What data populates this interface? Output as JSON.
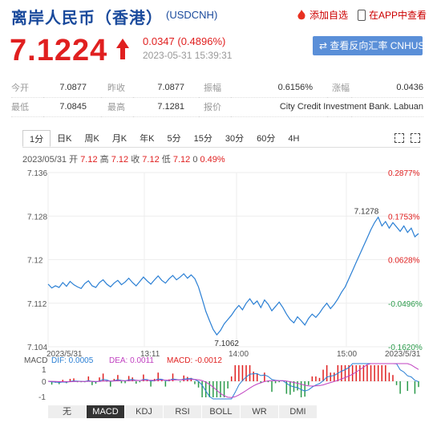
{
  "header": {
    "title": "离岸人民币（香港）",
    "code": "(USDCNH)",
    "fav_label": "添加自选",
    "app_label": "在APP中查看"
  },
  "quote": {
    "price": "7.1224",
    "change": "0.0347 (0.4896%)",
    "timestamp": "2023-05-31  15:39:31",
    "reverse_button": "查看反向汇率 CNHUSD"
  },
  "stats": [
    [
      {
        "l": "今开",
        "v": "7.0877"
      },
      {
        "l": "昨收",
        "v": "7.0877"
      },
      {
        "l": "振幅",
        "v": "0.6156%"
      },
      {
        "l": "涨幅",
        "v": "0.0436"
      }
    ],
    [
      {
        "l": "最低",
        "v": "7.0845"
      },
      {
        "l": "最高",
        "v": "7.1281"
      },
      {
        "l": "报价",
        "v": "City Credit Investment Bank. Labuan"
      }
    ]
  ],
  "tabs": [
    "1分",
    "日K",
    "周K",
    "月K",
    "年K",
    "5分",
    "15分",
    "30分",
    "60分",
    "4H"
  ],
  "info_line": {
    "date": "2023/05/31",
    "items": [
      [
        "开",
        "7.12"
      ],
      [
        "高",
        "7.12"
      ],
      [
        "收",
        "7.12"
      ],
      [
        "低",
        "7.12"
      ]
    ],
    "vol": "0",
    "pct": "0.49%"
  },
  "chart_data": {
    "type": "line",
    "y_ticks": [
      "7.136",
      "7.128",
      "7.12",
      "7.112",
      "7.104"
    ],
    "y_tick_values": [
      7.136,
      7.128,
      7.12,
      7.112,
      7.104
    ],
    "pct_ticks": [
      "0.2877%",
      "0.1753%",
      "0.0628%",
      "-0.0496%",
      "-0.1620%"
    ],
    "x_ticks": [
      "2023/5/31",
      "13:11",
      "14:00",
      "15:00",
      "2023/5/31"
    ],
    "ylim": [
      7.104,
      7.136
    ],
    "high_label": "7.1278",
    "low_label": "7.1062",
    "values": [
      7.1155,
      7.1148,
      7.1152,
      7.1149,
      7.1158,
      7.1151,
      7.116,
      7.1154,
      7.115,
      7.1147,
      7.1156,
      7.1161,
      7.1152,
      7.1149,
      7.1158,
      7.1163,
      7.1155,
      7.115,
      7.1157,
      7.1162,
      7.1154,
      7.1159,
      7.1166,
      7.1158,
      7.1152,
      7.116,
      7.1168,
      7.1161,
      7.1155,
      7.1163,
      7.117,
      7.1162,
      7.1157,
      7.1165,
      7.1171,
      7.1163,
      7.1168,
      7.1174,
      7.1166,
      7.1172,
      7.1165,
      7.115,
      7.1128,
      7.1105,
      7.1088,
      7.1072,
      7.1062,
      7.107,
      7.1082,
      7.109,
      7.1098,
      7.1108,
      7.1116,
      7.1108,
      7.112,
      7.1128,
      7.1118,
      7.1124,
      7.1112,
      7.1126,
      7.1118,
      7.1106,
      7.1114,
      7.1122,
      7.1112,
      7.11,
      7.109,
      7.1084,
      7.1095,
      7.1088,
      7.108,
      7.1092,
      7.11,
      7.1094,
      7.1102,
      7.1112,
      7.112,
      7.111,
      7.1118,
      7.1128,
      7.114,
      7.115,
      7.1165,
      7.118,
      7.1195,
      7.121,
      7.1225,
      7.124,
      7.1255,
      7.1268,
      7.1278,
      7.1262,
      7.127,
      7.1258,
      7.1268,
      7.126,
      7.1252,
      7.1262,
      7.125,
      7.1258,
      7.1242,
      7.1248
    ],
    "macd": {
      "dif_label": "DIF: 0.0005",
      "dea_label": "DEA: 0.0011",
      "macd_label": "MACD: -0.0012",
      "y_ticks": [
        "1",
        "0",
        "-1"
      ]
    }
  },
  "bottom_tabs": [
    "无",
    "MACD",
    "KDJ",
    "RSI",
    "BOLL",
    "WR",
    "DMI"
  ],
  "colors": {
    "up": "#e02020",
    "line": "#2a7fd4",
    "title": "#1a4a9c",
    "green": "#2a9a4a"
  }
}
